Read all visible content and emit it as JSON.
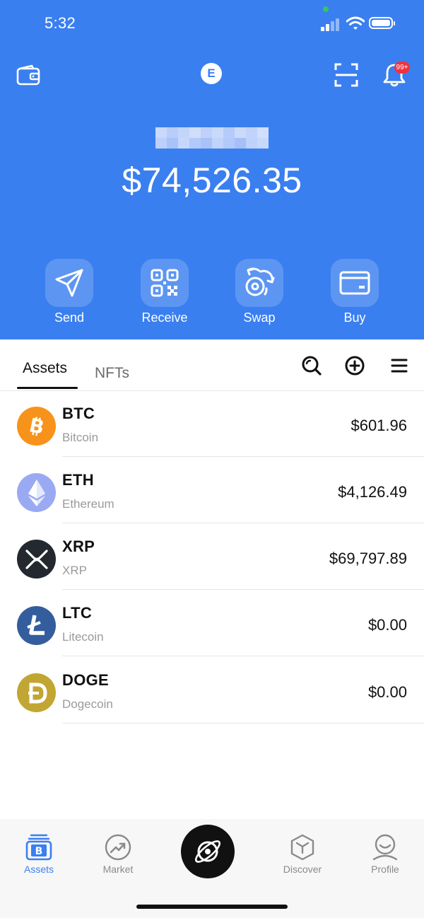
{
  "status_bar": {
    "time": "5:32"
  },
  "header": {
    "logo_letter": "E",
    "notification_badge": "99+",
    "balance": "$74,526.35"
  },
  "actions": [
    {
      "label": "Send",
      "icon": "send-icon"
    },
    {
      "label": "Receive",
      "icon": "qr-code-icon"
    },
    {
      "label": "Swap",
      "icon": "swap-icon"
    },
    {
      "label": "Buy",
      "icon": "card-icon"
    }
  ],
  "tabs": {
    "assets": "Assets",
    "nfts": "NFTs"
  },
  "assets": [
    {
      "symbol": "BTC",
      "name": "Bitcoin",
      "value": "$601.96",
      "color": "#f7931a"
    },
    {
      "symbol": "ETH",
      "name": "Ethereum",
      "value": "$4,126.49",
      "color": "#9aaaf2"
    },
    {
      "symbol": "XRP",
      "name": "XRP",
      "value": "$69,797.89",
      "color": "#23292f"
    },
    {
      "symbol": "LTC",
      "name": "Litecoin",
      "value": "$0.00",
      "color": "#345d9d"
    },
    {
      "symbol": "DOGE",
      "name": "Dogecoin",
      "value": "$0.00",
      "color": "#c2a633"
    }
  ],
  "bottom_nav": {
    "assets": "Assets",
    "market": "Market",
    "discover": "Discover",
    "profile": "Profile"
  },
  "colors": {
    "brand": "#3a7ff0",
    "active_nav": "#3a7ff0",
    "badge": "#f0323f"
  }
}
